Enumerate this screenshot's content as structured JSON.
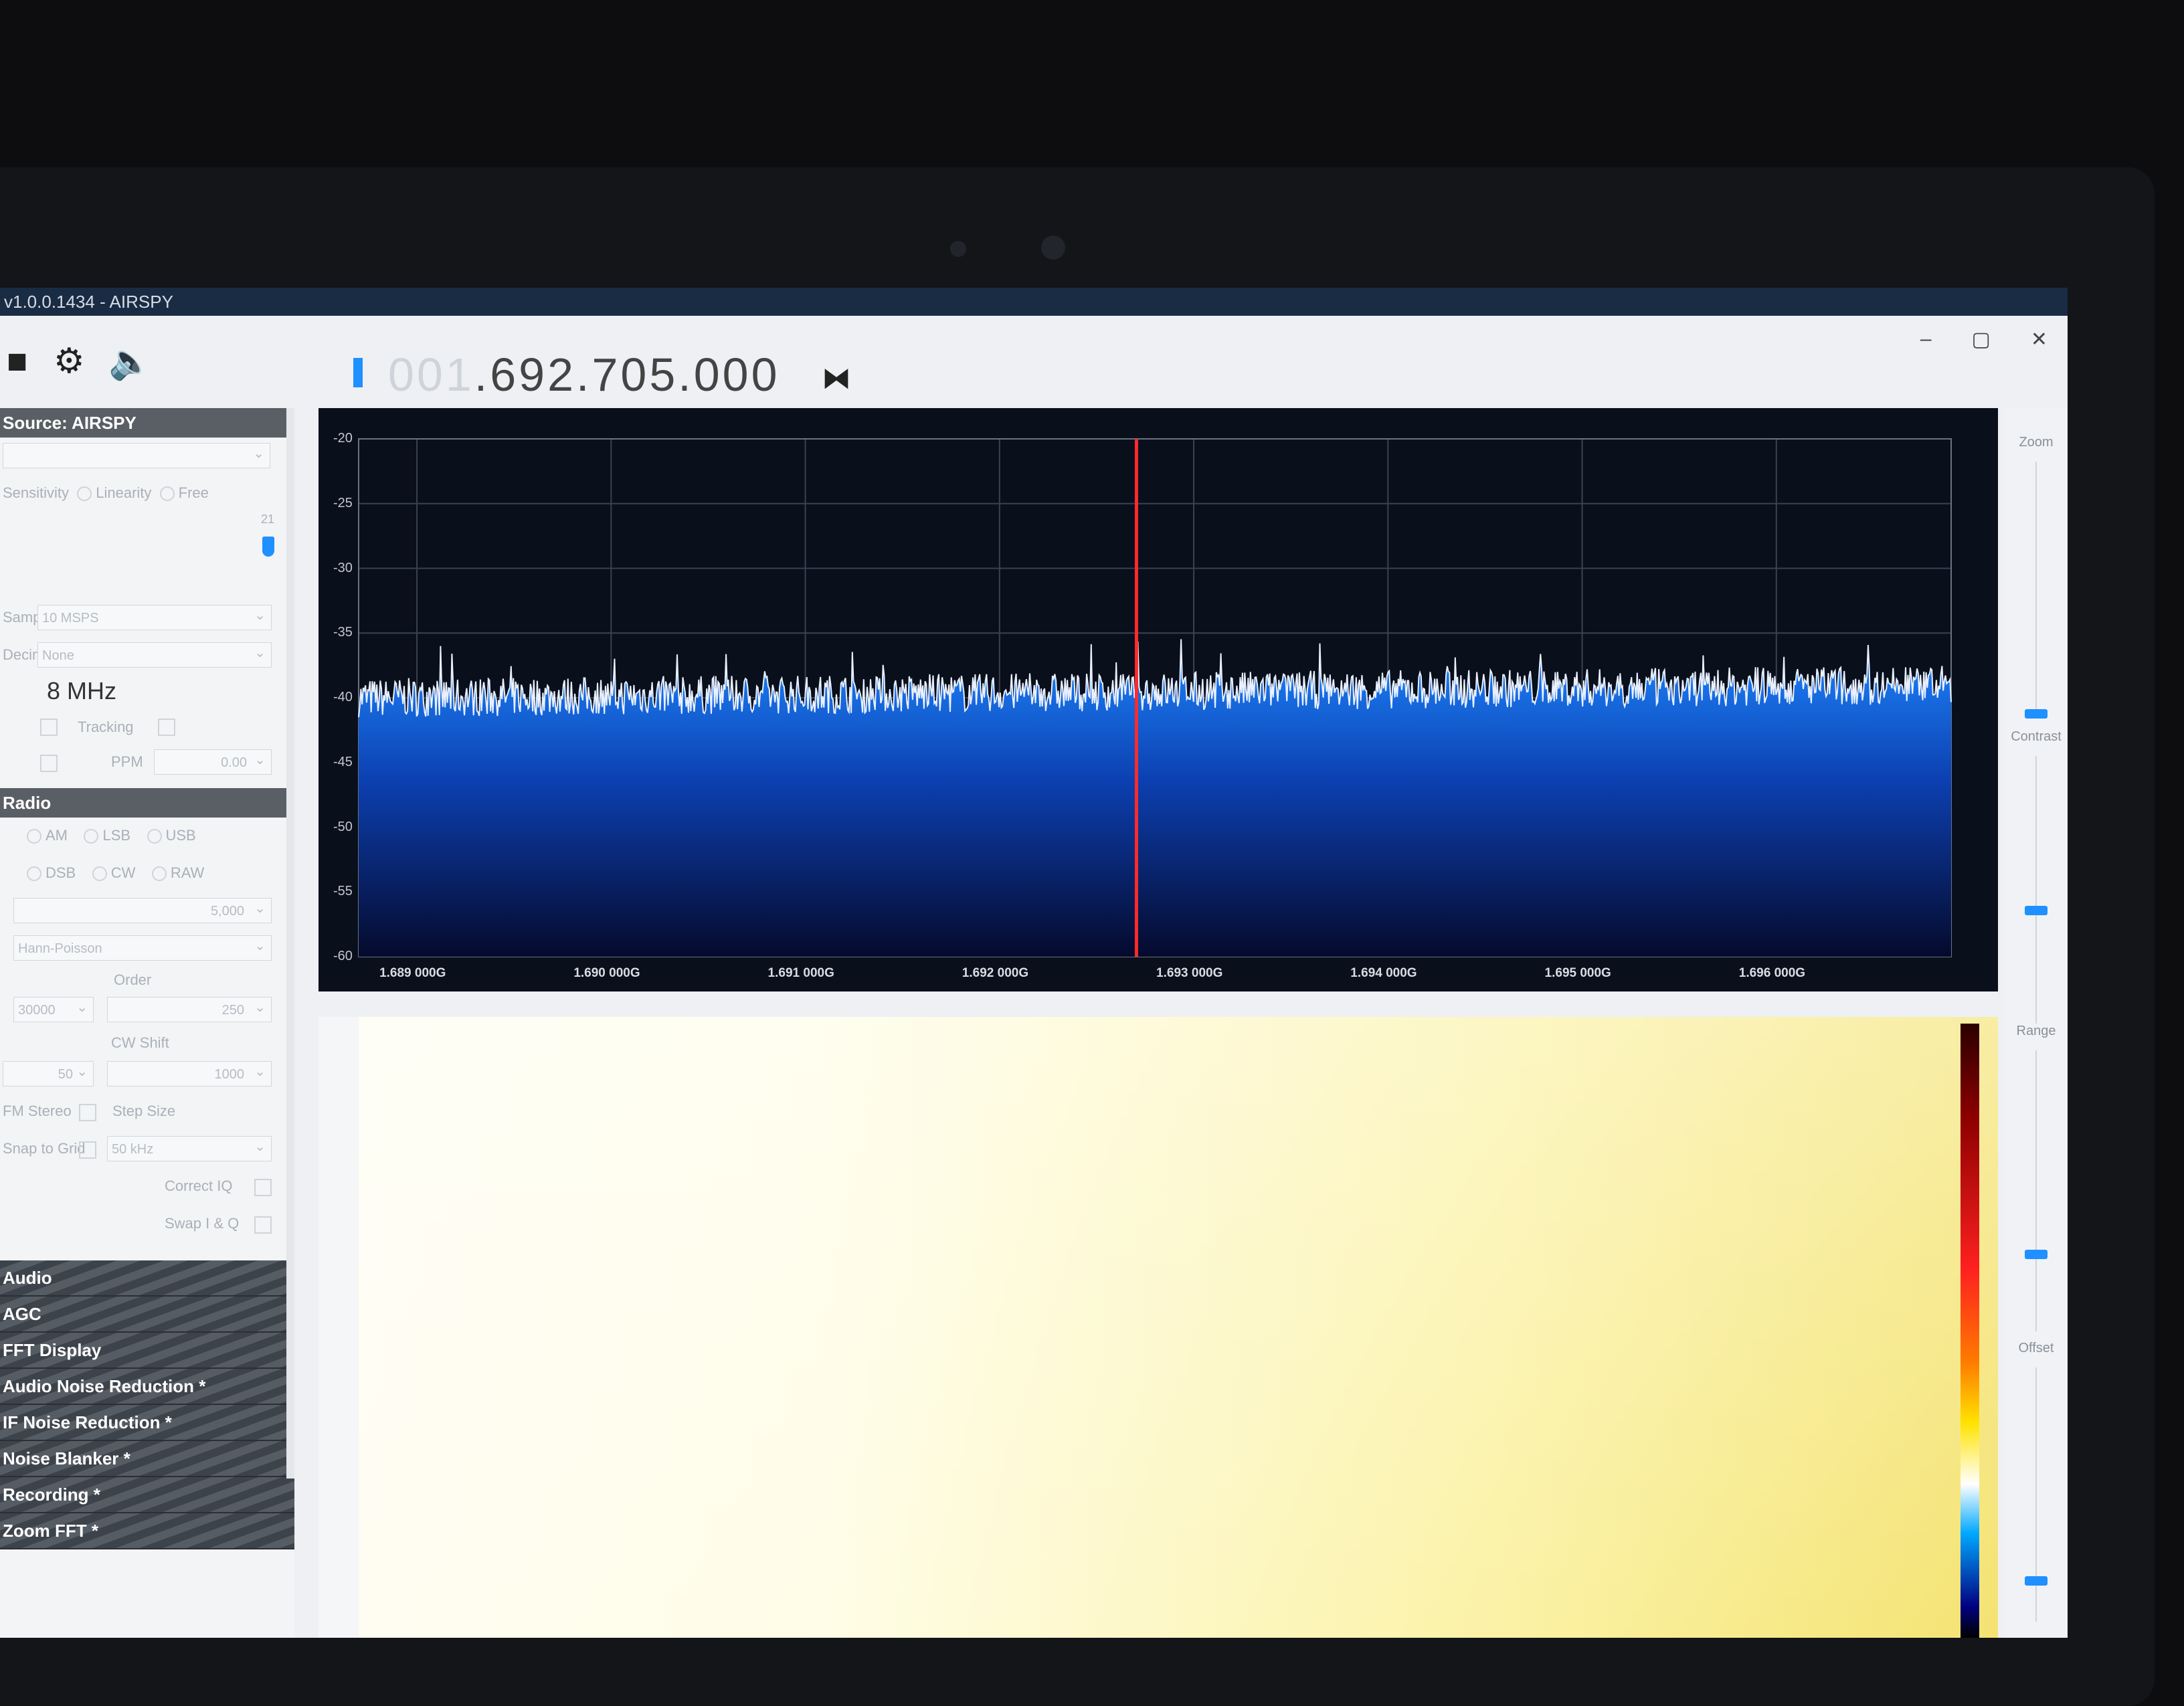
{
  "window": {
    "title": "v1.0.0.1434 - AIRSPY",
    "controls": [
      "–",
      "▢",
      "✕"
    ]
  },
  "toolbar": {
    "icons": [
      "stop-icon",
      "gear-icon",
      "speaker-icon"
    ],
    "frequency_dim": "001",
    "frequency_main": ".692.705.000",
    "frequency_display": "001.692.705.000"
  },
  "left_panel": {
    "source_header": "Source: AIRSPY",
    "gain_modes": [
      "Sensitivity",
      "Linearity",
      "Free"
    ],
    "gain_value": "21",
    "sample_rate_label": "Sample Rate",
    "sample_rate_value": "10 MSPS",
    "decimation_label": "Decimation",
    "decimation_value": "None",
    "bandwidth_value": "8 MHz",
    "tracking_label": "Tracking",
    "ppm_label": "PPM",
    "ppm_value": "0.00",
    "radio_header": "Radio",
    "modes_row1": [
      "AM",
      "LSB",
      "USB"
    ],
    "modes_row2": [
      "DSB",
      "CW",
      "RAW"
    ],
    "filter_bw_value": "5,000",
    "filter_type_value": "Hann-Poisson",
    "order_label": "Order",
    "order_value": "30000",
    "order_value2": "250",
    "cw_shift_label": "CW Shift",
    "squelch_value": "50",
    "cw_shift_value": "1000",
    "fm_stereo_label": "FM Stereo",
    "step_size_label": "Step Size",
    "snap_label": "Snap to Grid",
    "step_value": "50 kHz",
    "correct_iq_label": "Correct IQ",
    "swap_iq_label": "Swap I & Q",
    "collapsed": [
      "Audio",
      "AGC",
      "FFT Display",
      "Audio Noise Reduction *",
      "IF Noise Reduction *",
      "Noise Blanker *",
      "Recording *",
      "Zoom FFT *"
    ]
  },
  "right_panel": {
    "zoom_label": "Zoom",
    "contrast_label": "Contrast",
    "range_label": "Range",
    "offset_label": "Offset"
  },
  "chart_data": {
    "type": "line",
    "title": "",
    "xlabel": "",
    "ylabel": "",
    "y_ticks": [
      "-20",
      "-25",
      "-30",
      "-35",
      "-40",
      "-45",
      "-50",
      "-55",
      "-60"
    ],
    "x_ticks": [
      "1.689 000G",
      "1.690 000G",
      "1.691 000G",
      "1.692 000G",
      "1.693 000G",
      "1.694 000G",
      "1.695 000G",
      "1.696 000G"
    ],
    "ylim": [
      -60,
      -20
    ],
    "xlim": [
      1688.7,
      1696.9
    ],
    "center_marker_mhz": 1692.705,
    "noise_floor_db": -40,
    "noise_floor_end_db": -39,
    "grid": true
  }
}
